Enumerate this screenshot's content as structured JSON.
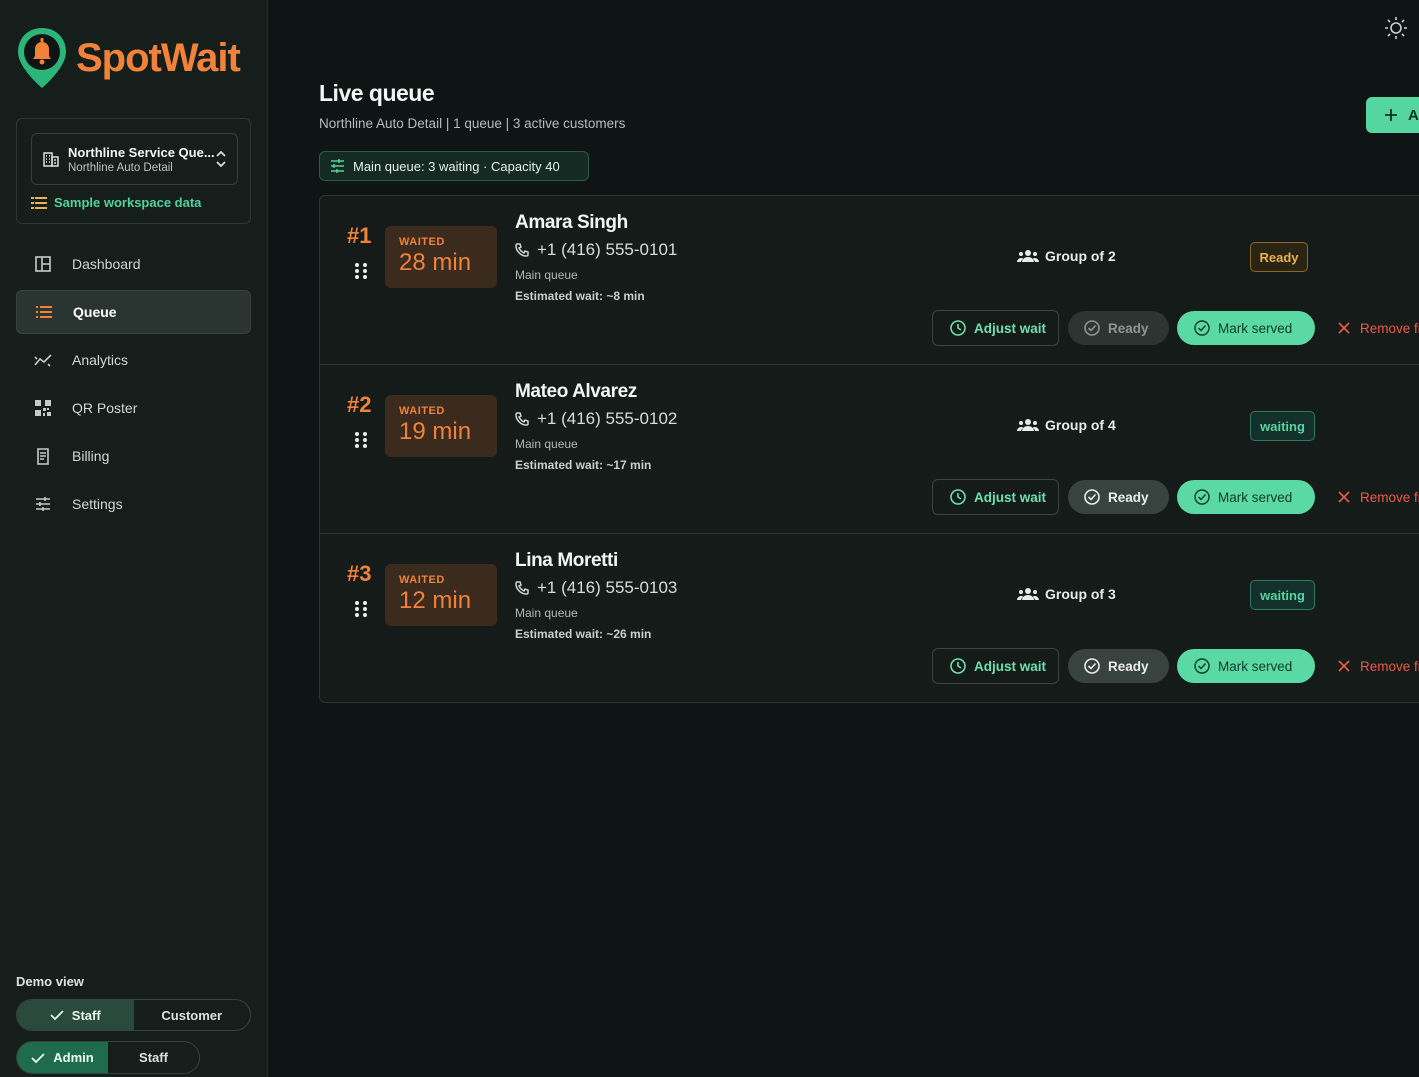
{
  "app": {
    "brand": "SpotWait"
  },
  "workspace": {
    "name": "Northline Service Que...",
    "business": "Northline Auto Detail",
    "sample_label": "Sample workspace data"
  },
  "nav": [
    {
      "label": "Dashboard",
      "icon": "dashboard-icon"
    },
    {
      "label": "Queue",
      "icon": "list-icon",
      "active": true
    },
    {
      "label": "Analytics",
      "icon": "analytics-icon"
    },
    {
      "label": "QR Poster",
      "icon": "qr-code-icon"
    },
    {
      "label": "Billing",
      "icon": "receipt-icon"
    },
    {
      "label": "Settings",
      "icon": "sliders-icon"
    }
  ],
  "demo": {
    "label": "Demo view",
    "view_options": [
      "Staff",
      "Customer"
    ],
    "role_options": [
      "Admin",
      "Staff"
    ]
  },
  "header": {
    "title": "Live queue",
    "subtitle": "Northline Auto Detail | 1 queue | 3 active customers",
    "add_label": "A",
    "filter_chip": "Main queue: 3 waiting · Capacity 40"
  },
  "queue": [
    {
      "position": "#1",
      "waited_label": "WAITED",
      "waited": "28 min",
      "name": "Amara Singh",
      "phone": "+1 (416) 555-0101",
      "queue": "Main queue",
      "estimate": "Estimated wait: ~8 min",
      "group": "Group of 2",
      "status": "Ready",
      "adjust": "Adjust wait",
      "ready": "Ready",
      "served": "Mark served",
      "remove": "Remove fr"
    },
    {
      "position": "#2",
      "waited_label": "WAITED",
      "waited": "19 min",
      "name": "Mateo Alvarez",
      "phone": "+1 (416) 555-0102",
      "queue": "Main queue",
      "estimate": "Estimated wait: ~17 min",
      "group": "Group of 4",
      "status": "waiting",
      "adjust": "Adjust wait",
      "ready": "Ready",
      "served": "Mark served",
      "remove": "Remove fr"
    },
    {
      "position": "#3",
      "waited_label": "WAITED",
      "waited": "12 min",
      "name": "Lina Moretti",
      "phone": "+1 (416) 555-0103",
      "queue": "Main queue",
      "estimate": "Estimated wait: ~26 min",
      "group": "Group of 3",
      "status": "waiting",
      "adjust": "Adjust wait",
      "ready": "Ready",
      "served": "Mark served",
      "remove": "Remove fr"
    }
  ],
  "colors": {
    "accent": "#f0823a",
    "brand_green": "#55d6a0",
    "danger": "#ec5a4a"
  }
}
